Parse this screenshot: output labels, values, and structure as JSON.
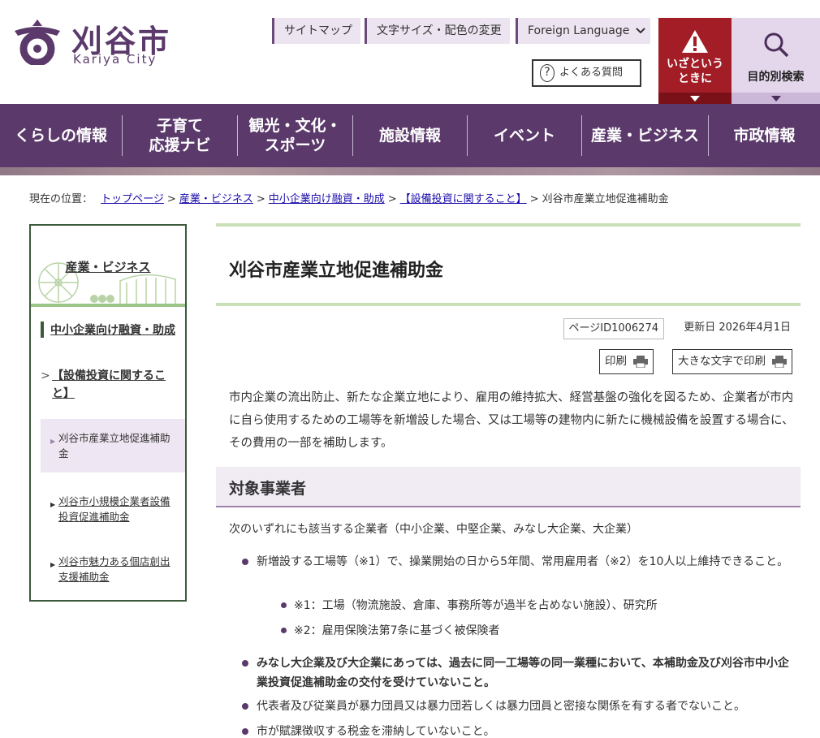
{
  "header": {
    "logo_jp": "刈谷市",
    "logo_en": "Kariya City",
    "sitemap": "サイトマップ",
    "text_size": "文字サイズ・配色の変更",
    "foreign": "Foreign Language",
    "faq": "よくある質問",
    "emergency": "いざという\nときに",
    "emergency_line1": "いざという",
    "emergency_line2": "ときに",
    "search": "目的別検索"
  },
  "nav": {
    "items": [
      {
        "line1": "くらしの情報",
        "line2": ""
      },
      {
        "line1": "子育て",
        "line2": "応援ナビ"
      },
      {
        "line1": "観光・文化・",
        "line2": "スポーツ"
      },
      {
        "line1": "施設情報",
        "line2": ""
      },
      {
        "line1": "イベント",
        "line2": ""
      },
      {
        "line1": "産業・ビジネス",
        "line2": ""
      },
      {
        "line1": "市政情報",
        "line2": ""
      }
    ]
  },
  "breadcrumb": {
    "label": "現在の位置：",
    "links": [
      "トップページ",
      "産業・ビジネス",
      "中小企業向け融資・助成",
      "【設備投資に関すること】"
    ],
    "current": "刈谷市産業立地促進補助金",
    "separator": ">"
  },
  "sidebar": {
    "title": "産業・ビジネス",
    "category": "中小企業向け融資・助成",
    "subcategory": "【設備投資に関すること】",
    "links": [
      {
        "label": "刈谷市産業立地促進補助金",
        "line1": "刈谷市産業立地促進補助",
        "line2": "金",
        "active": true
      },
      {
        "label": "刈谷市小規模企業者設備投資促進補助金",
        "line1": "刈谷市小規模企業者設備",
        "line2": "投資促進補助金",
        "active": false
      },
      {
        "label": "刈谷市魅力ある個店創出支援補助金",
        "line1": "刈谷市魅力ある個店創出",
        "line2": "支援補助金",
        "active": false
      }
    ]
  },
  "main": {
    "title": "刈谷市産業立地促進補助金",
    "page_id": "ページID1006274",
    "updated": "更新日 2026年4月1日",
    "print": "印刷",
    "print_large": "大きな文字で印刷",
    "lead": "市内企業の流出防止、新たな企業立地により、雇用の維持拡大、経営基盤の強化を図るため、企業者が市内に自ら使用するための工場等を新増設した場合、又は工場等の建物内に新たに機械設備を設置する場合に、その費用の一部を補助します。",
    "section_title": "対象事業者",
    "intro": "次のいずれにも該当する企業者（中小企業、中堅企業、みなし大企業、大企業）",
    "bullets": [
      "新増設する工場等（※1）で、操業開始の日から5年間、常用雇用者（※2）を10人以上維持できること。",
      "みなし大企業及び大企業にあっては、過去に同一工場等の同一業種において、本補助金及び刈谷市中小企業投資促進補助金の交付を受けていないこと。",
      "代表者及び従業員が暴力団員又は暴力団若しくは暴力団員と密接な関係を有する者でないこと。",
      "市が賦課徴収する税金を滞納していないこと。"
    ],
    "notes": [
      "※1：工場（物流施設、倉庫、事務所等が過半を占めない施設）、研究所",
      "※2：雇用保険法第7条に基づく被保険者"
    ]
  },
  "colors": {
    "brand_purple": "#5b3a6b",
    "emergency_red": "#a21d26",
    "accent_green": "#c9dfb6"
  }
}
